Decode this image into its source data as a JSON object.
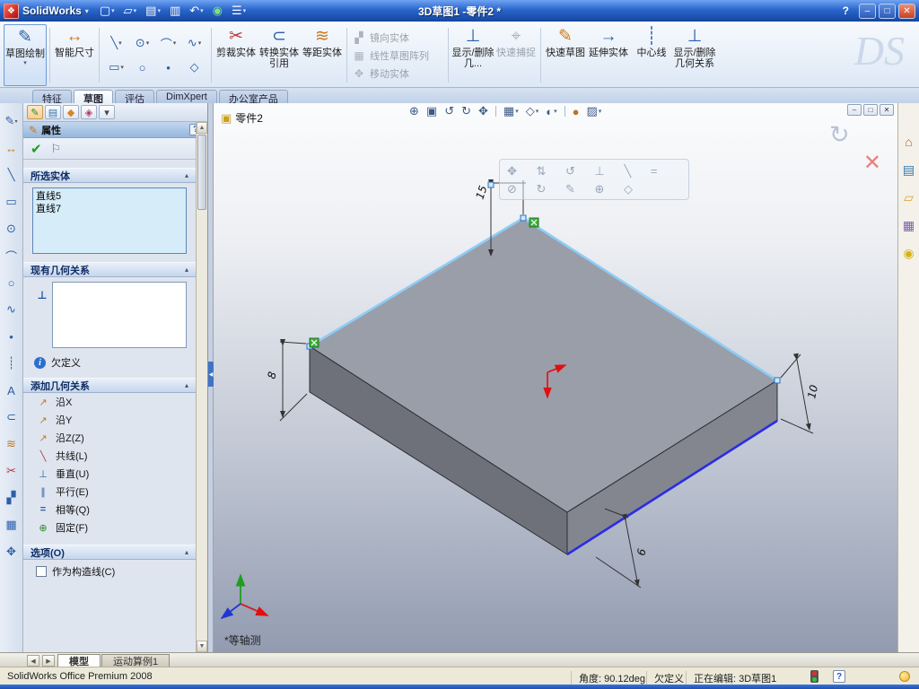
{
  "ui": {
    "dropdown_glyph": "▾",
    "up_glyph": "▲",
    "down_glyph": "▼",
    "left_glyph": "◀",
    "collapse_glyph": "▴"
  },
  "titlebar": {
    "logo_glyph": "❖",
    "app_name": "SolidWorks",
    "doc_title": "3D草图1 -零件2 *",
    "help_label": "?",
    "minimize_glyph": "–",
    "restore_glyph": "□",
    "close_glyph": "✕",
    "tools": [
      {
        "name": "new-document",
        "glyph": "▢"
      },
      {
        "name": "open",
        "glyph": "▱"
      },
      {
        "name": "save",
        "glyph": "▤"
      },
      {
        "name": "print",
        "glyph": "▥"
      },
      {
        "name": "undo",
        "glyph": "↶"
      },
      {
        "name": "rebuild",
        "glyph": "◉"
      },
      {
        "name": "options",
        "glyph": "☰"
      }
    ]
  },
  "ribbon": {
    "watermark": "DS",
    "sketch_label": "草图绘制",
    "smart_dimension_label": "智能尺寸",
    "tools": [
      {
        "name": "line-tool",
        "glyph": "╲"
      },
      {
        "name": "circle-tool",
        "glyph": "⊙"
      },
      {
        "name": "arc-tool",
        "glyph": "⌒"
      },
      {
        "name": "spline-tool",
        "glyph": "∿"
      },
      {
        "name": "rectangle-tool",
        "glyph": "▭"
      },
      {
        "name": "ellipse-tool",
        "glyph": "○"
      },
      {
        "name": "point-tool",
        "glyph": "•"
      },
      {
        "name": "polygon-tool",
        "glyph": "◇"
      }
    ],
    "icons": {
      "sketch": "✎",
      "smart_dimension": "↔",
      "trim": "✂",
      "convert": "⊂",
      "offset": "≋",
      "mirror": "▞",
      "pattern": "▦",
      "move": "✥",
      "display_delete_short": "⊥",
      "quick_snaps": "⌖",
      "rapid_sketch": "✎",
      "extend": "→",
      "centerline": "┊",
      "display_delete": "⊥"
    },
    "trim_label": "剪裁实体",
    "convert_label": "转换实体引用",
    "offset_label": "等距实体",
    "mirror_label": "镜向实体",
    "pattern_label": "线性草图阵列",
    "move_label": "移动实体",
    "display_delete_short_label": "显示/删除几...",
    "quick_snaps_label": "快速捕捉",
    "rapid_sketch_label": "快速草图",
    "extend_label": "延伸实体",
    "centerline_label": "中心线",
    "display_delete_label": "显示/删除几何关系",
    "tabs": [
      {
        "label": "特征"
      },
      {
        "label": "草图"
      },
      {
        "label": "评估"
      },
      {
        "label": "DimXpert"
      },
      {
        "label": "办公室产品"
      }
    ]
  },
  "left_toolbar": {
    "items": [
      {
        "name": "sketch",
        "glyph": "✎"
      },
      {
        "name": "smart-dimension",
        "glyph": "↔"
      },
      {
        "name": "line",
        "glyph": "╲"
      },
      {
        "name": "rectangle",
        "glyph": "▭"
      },
      {
        "name": "circle",
        "glyph": "⊙"
      },
      {
        "name": "arc",
        "glyph": "⌒"
      },
      {
        "name": "ellipse",
        "glyph": "○"
      },
      {
        "name": "spline",
        "glyph": "∿"
      },
      {
        "name": "point",
        "glyph": "•"
      },
      {
        "name": "centerline",
        "glyph": "┊"
      },
      {
        "name": "text",
        "glyph": "A"
      },
      {
        "name": "convert-entities",
        "glyph": "⊂"
      },
      {
        "name": "offset-entities",
        "glyph": "≋"
      },
      {
        "name": "trim-entities",
        "glyph": "✂"
      },
      {
        "name": "mirror-entities",
        "glyph": "▞"
      },
      {
        "name": "linear-pattern",
        "glyph": "▦"
      },
      {
        "name": "move-entities",
        "glyph": "✥"
      }
    ]
  },
  "property_manager": {
    "tabs": [
      {
        "name": "propertymanager-tab",
        "glyph": "✎"
      },
      {
        "name": "configurationmanager-tab",
        "glyph": "▤"
      },
      {
        "name": "dimxpertmanager-tab",
        "glyph": "◆"
      },
      {
        "name": "displaymanager-tab",
        "glyph": "◈"
      },
      {
        "name": "panel-chevron",
        "glyph": "▾"
      }
    ],
    "title": "属性",
    "header_icon_glyph": "✎",
    "help_glyph": "?",
    "ok_glyph": "✔",
    "pin_glyph": "⚐",
    "selected_entities": {
      "title": "所选实体",
      "items": [
        "直线5",
        "直线7"
      ]
    },
    "existing_relations": {
      "title": "现有几何关系",
      "side_icon_glyph": "⊥"
    },
    "info_glyph": "i",
    "status_text": "欠定义",
    "add_relations": {
      "title": "添加几何关系",
      "buttons": [
        {
          "label": "沿X",
          "glyph": "↗"
        },
        {
          "label": "沿Y",
          "glyph": "↗"
        },
        {
          "label": "沿Z(Z)",
          "glyph": "↗"
        },
        {
          "label": "共线(L)",
          "glyph": "╲"
        },
        {
          "label": "垂直(U)",
          "glyph": "⊥"
        },
        {
          "label": "平行(E)",
          "glyph": "∥"
        },
        {
          "label": "相等(Q)",
          "glyph": "="
        },
        {
          "label": "固定(F)",
          "glyph": "⊕"
        }
      ]
    },
    "options": {
      "title": "选项(O)",
      "construction_label": "作为构造线(C)"
    }
  },
  "graphics": {
    "part_name": "零件2",
    "part_icon_glyph": "▣",
    "view_label": "*等轴测",
    "dimensions": {
      "top": "15",
      "left": "8",
      "right": "10",
      "bottom": "6"
    },
    "headsup": [
      {
        "name": "zoom-fit",
        "glyph": "⊕"
      },
      {
        "name": "zoom-area",
        "glyph": "▣"
      },
      {
        "name": "previous-view",
        "glyph": "↺"
      },
      {
        "name": "rotate-view",
        "glyph": "↻"
      },
      {
        "name": "pan",
        "glyph": "✥"
      },
      {
        "name": "standard-views",
        "glyph": "▦"
      },
      {
        "name": "display-style",
        "glyph": "◇"
      },
      {
        "name": "hide-show-items",
        "glyph": "◐"
      },
      {
        "name": "edit-appearance",
        "glyph": "●"
      },
      {
        "name": "apply-scene",
        "glyph": "▨"
      }
    ],
    "doc_buttons": {
      "minimize": "–",
      "restore": "□",
      "close": "✕"
    },
    "context_toolbar": {
      "row1": "✥ ⇅ ↺ ⊥ ╲ =",
      "row2": "⊘ ↻ ✎ ⊕ ◇"
    },
    "confirmation": {
      "accept_glyph": "↻",
      "cancel_glyph": "✕"
    }
  },
  "task_pane": {
    "items": [
      {
        "name": "resources-home",
        "glyph": "⌂",
        "color": "#c06020"
      },
      {
        "name": "design-library",
        "glyph": "▤",
        "color": "#2e75b6"
      },
      {
        "name": "file-explorer",
        "glyph": "▱",
        "color": "#d8a12f"
      },
      {
        "name": "view-palette",
        "glyph": "▦",
        "color": "#7a5ab5"
      },
      {
        "name": "appearances",
        "glyph": "◉",
        "color": "#d8b21a"
      }
    ]
  },
  "bottom_tabs": {
    "nav_left": "◀",
    "nav_right": "▶",
    "tabs": [
      {
        "label": "模型"
      },
      {
        "label": "运动算例1"
      }
    ]
  },
  "statusbar": {
    "product": "SolidWorks Office Premium 2008",
    "angle": "角度: 90.12deg",
    "state": "欠定义",
    "editing": "正在编辑: 3D草图1",
    "help_glyph": "?"
  }
}
